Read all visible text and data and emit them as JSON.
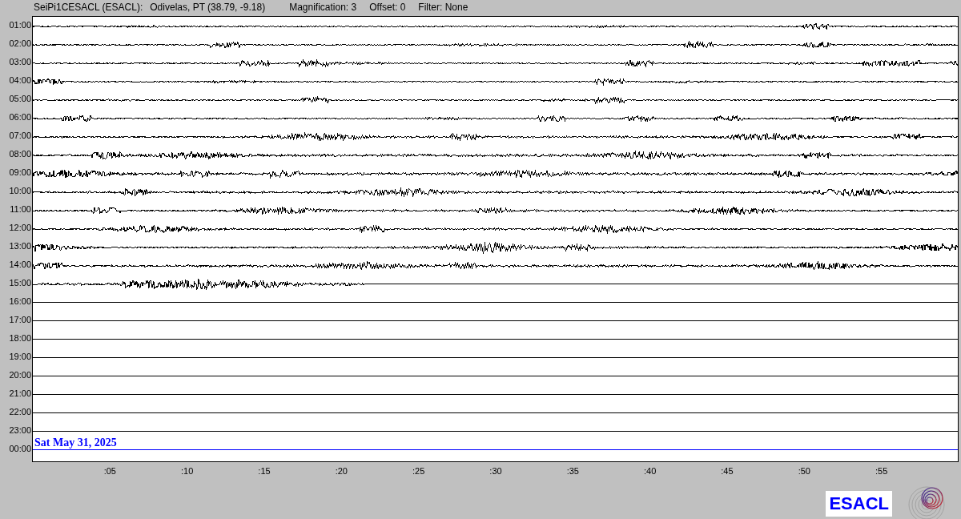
{
  "header": {
    "station": "SeiPi1CESACL (ESACL):",
    "location": "Odivelas, PT (38.79, -9.18)",
    "magnification": "Magnification: 3",
    "offset": "Offset: 0",
    "filter": "Filter: None"
  },
  "rows": [
    {
      "label": "01:00",
      "kind": "recorded",
      "color": "#000000"
    },
    {
      "label": "02:00",
      "kind": "recorded",
      "color": "#000000"
    },
    {
      "label": "03:00",
      "kind": "recorded",
      "color": "#000000"
    },
    {
      "label": "04:00",
      "kind": "recorded",
      "color": "#000000"
    },
    {
      "label": "05:00",
      "kind": "recorded",
      "color": "#000000"
    },
    {
      "label": "06:00",
      "kind": "recorded",
      "color": "#000000"
    },
    {
      "label": "07:00",
      "kind": "recorded",
      "color": "#000000"
    },
    {
      "label": "08:00",
      "kind": "recorded",
      "color": "#000000"
    },
    {
      "label": "09:00",
      "kind": "recorded",
      "color": "#000000"
    },
    {
      "label": "10:00",
      "kind": "recorded",
      "color": "#000000"
    },
    {
      "label": "11:00",
      "kind": "recorded",
      "color": "#000000"
    },
    {
      "label": "12:00",
      "kind": "recorded",
      "color": "#000000"
    },
    {
      "label": "13:00",
      "kind": "recorded",
      "color": "#000000"
    },
    {
      "label": "14:00",
      "kind": "recorded",
      "color": "#000000"
    },
    {
      "label": "15:00",
      "kind": "partial",
      "color": "#000000"
    },
    {
      "label": "16:00",
      "kind": "empty",
      "color": "#000000"
    },
    {
      "label": "17:00",
      "kind": "empty",
      "color": "#000000"
    },
    {
      "label": "18:00",
      "kind": "empty",
      "color": "#000000"
    },
    {
      "label": "19:00",
      "kind": "empty",
      "color": "#000000"
    },
    {
      "label": "20:00",
      "kind": "empty",
      "color": "#000000"
    },
    {
      "label": "21:00",
      "kind": "empty",
      "color": "#000000"
    },
    {
      "label": "22:00",
      "kind": "empty",
      "color": "#000000"
    },
    {
      "label": "23:00",
      "kind": "empty",
      "color": "#000000"
    },
    {
      "label": "00:00",
      "kind": "empty",
      "color": "#0000ff"
    }
  ],
  "date_label": "Sat May 31, 2025",
  "x_ticks": [
    ":05",
    ":10",
    ":15",
    ":20",
    ":25",
    ":30",
    ":35",
    ":40",
    ":45",
    ":50",
    ":55"
  ],
  "logo_text": "ESACL"
}
